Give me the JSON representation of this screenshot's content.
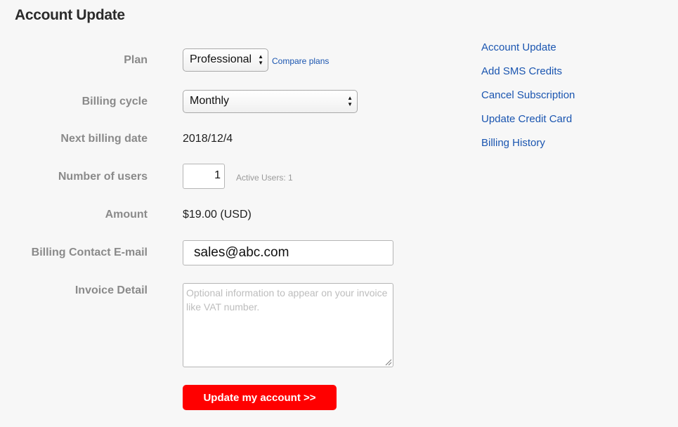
{
  "page": {
    "title": "Account Update"
  },
  "form": {
    "plan": {
      "label": "Plan",
      "selected": "Professional",
      "compare_link": "Compare plans"
    },
    "billing_cycle": {
      "label": "Billing cycle",
      "selected": "Monthly"
    },
    "next_billing_date": {
      "label": "Next billing date",
      "value": "2018/12/4"
    },
    "number_of_users": {
      "label": "Number of users",
      "value": "1",
      "active_users_note": "Active Users: 1"
    },
    "amount": {
      "label": "Amount",
      "value": "$19.00 (USD)"
    },
    "billing_email": {
      "label": "Billing Contact E-mail",
      "value": "sales@abc.com"
    },
    "invoice_detail": {
      "label": "Invoice Detail",
      "placeholder": "Optional information to appear on your invoice like VAT number."
    },
    "submit_label": "Update my account >>"
  },
  "side_nav": {
    "items": [
      {
        "label": "Account Update"
      },
      {
        "label": "Add SMS Credits"
      },
      {
        "label": "Cancel Subscription"
      },
      {
        "label": "Update Credit Card"
      },
      {
        "label": "Billing History"
      }
    ]
  },
  "colors": {
    "background": "#f7f7f7",
    "link": "#1a55b0",
    "label": "#8a8a8a",
    "submit_button": "#ff0000"
  }
}
